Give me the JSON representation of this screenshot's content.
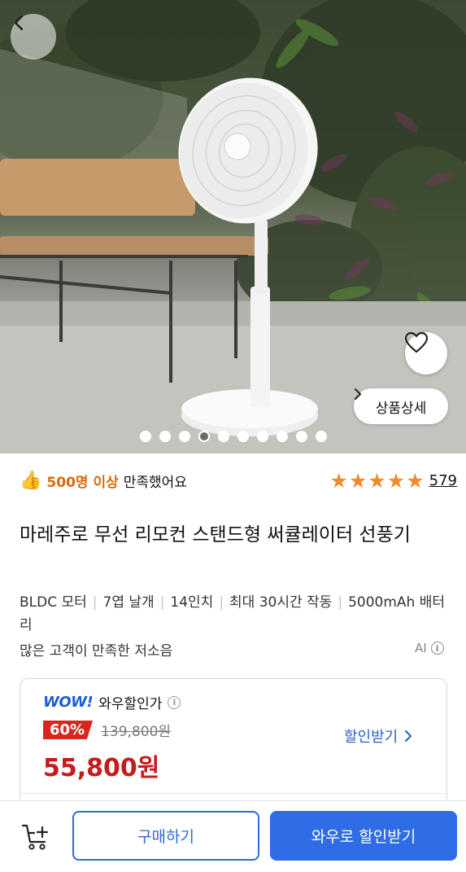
{
  "hero": {
    "image_alt": "white stand fan in front of plant wall",
    "back_icon": "chevron-left-icon",
    "heart_icon": "heart-outline-icon",
    "detail_label": "상품상세",
    "detail_icon": "chevron-right-icon",
    "gallery": {
      "total": 10,
      "active_index": 3
    }
  },
  "rating": {
    "thumb_icon": "thumbs-up-icon",
    "satisfaction_highlight": "500명 이상",
    "satisfaction_rest": "만족했어요",
    "stars": 5,
    "review_count": "579"
  },
  "product": {
    "title": "마레주로 무선 리모컨 스탠드형 써큘레이터 선풍기",
    "features": [
      "BLDC 모터",
      "7엽 날개",
      "14인치",
      "최대 30시간 작동",
      "5000mAh 배터리"
    ],
    "subnote": "많은 고객이 만족한 저소음",
    "ai_label": "AI"
  },
  "price": {
    "wow_logo": "WOW!",
    "wow_label": "와우할인가",
    "discount_percent": "60%",
    "original_price": "139,800원",
    "sale_price": "55,800원",
    "discount_link": "할인받기"
  },
  "bottom_bar": {
    "cart_icon": "cart-add-icon",
    "buy_label": "구매하기",
    "wow_buy_label": "와우로 할인받기"
  },
  "colors": {
    "accent_blue": "#2e6de6",
    "sale_red": "#c81a1a",
    "star_orange": "#f28a2b",
    "badge_red": "#d8261f"
  }
}
